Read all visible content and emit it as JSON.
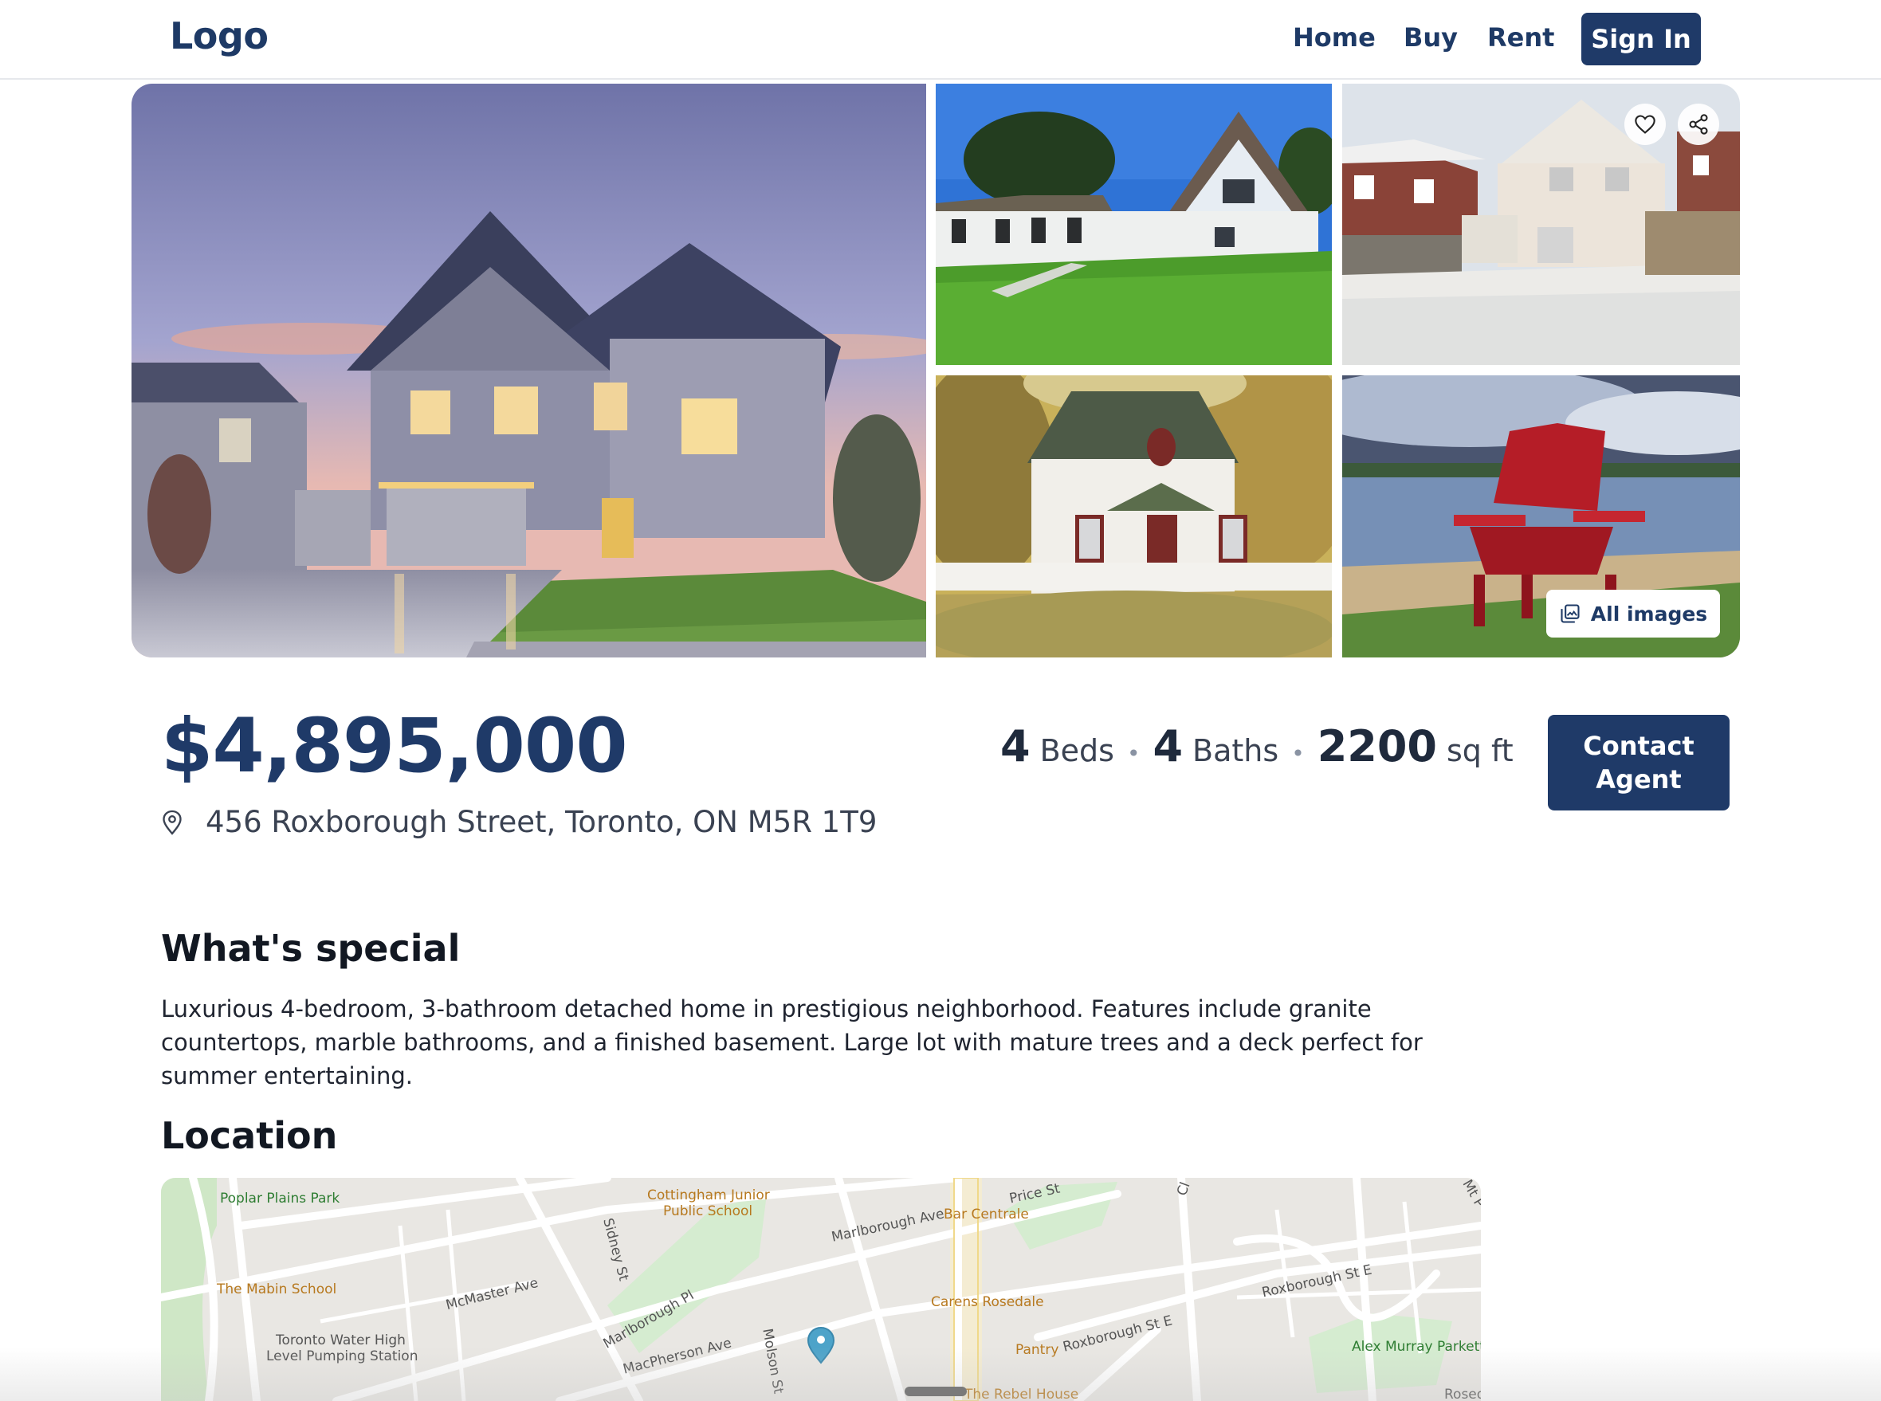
{
  "header": {
    "logo": "Logo",
    "nav": [
      "Home",
      "Buy",
      "Rent"
    ],
    "sign_in": "Sign In"
  },
  "gallery": {
    "all_images_label": "All images",
    "icons": [
      "heart-icon",
      "share-icon",
      "images-icon"
    ]
  },
  "listing": {
    "price": "$4,895,000",
    "address": "456 Roxborough Street, Toronto, ON M5R 1T9",
    "beds_num": "4",
    "beds_label": "Beds",
    "baths_num": "4",
    "baths_label": "Baths",
    "sqft_num": "2200",
    "sqft_label": "sq ft",
    "separator": "•",
    "contact_label_1": "Contact",
    "contact_label_2": "Agent"
  },
  "sections": {
    "special_title": "What's special",
    "special_text": "Luxurious 4-bedroom, 3-bathroom detached home in prestigious neighborhood. Features include granite countertops, marble bathrooms, and a finished basement. Large lot with mature trees and a deck perfect for summer entertaining.",
    "location_title": "Location"
  },
  "map": {
    "labels": {
      "poplar": "Poplar Plains Park",
      "cottingham": "Cottingham Junior",
      "cottingham2": "Public School",
      "price_st": "Price St",
      "bar": "Bar Centrale",
      "marlborough_ave": "Marlborough Ave",
      "sidney": "Sidney St",
      "mabin": "The Mabin School",
      "mcmaster": "McMaster Ave",
      "marlborough_pl": "Marlborough Pl",
      "carens": "Carens Rosedale",
      "roxborough1": "Roxborough St E",
      "roxborough2": "Roxborough St E",
      "pantry": "Pantry",
      "water1": "Toronto Water High",
      "water2": "Level Pumping Station",
      "macpherson": "MacPherson Ave",
      "molson": "Molson St",
      "rebel": "The Rebel House",
      "alex": "Alex Murray Parkette",
      "rosed": "Rosed",
      "clt": "Cl",
      "mtp": "Mt P"
    }
  },
  "colors": {
    "brand": "#1f3a68",
    "map_pin": "#4da3c9"
  }
}
